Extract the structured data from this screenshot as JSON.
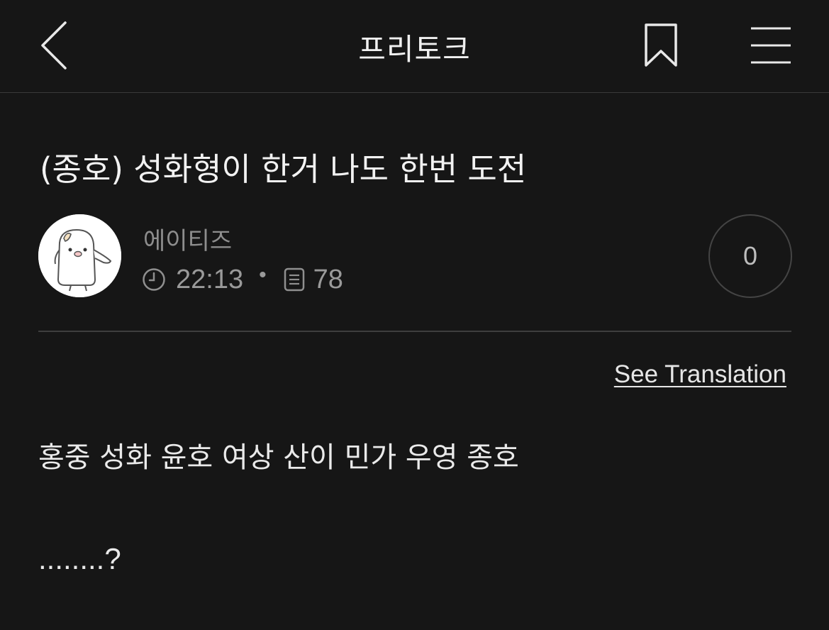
{
  "header": {
    "title": "프리토크",
    "icons": {
      "back": "chevron-left-icon",
      "bookmark": "bookmark-icon",
      "menu": "hamburger-menu-icon"
    }
  },
  "post": {
    "title": "(종호) 성화형이 한거 나도 한번 도전",
    "author": {
      "name": "에이티즈",
      "avatar": "penguin-character-avatar"
    },
    "time": "22:13",
    "views": "78",
    "comment_count": "0",
    "see_translation": "See Translation",
    "body": [
      "홍중 성화 윤호 여상 산이 민가 우영 종호",
      "........?"
    ]
  },
  "colors": {
    "background": "#161616",
    "text": "#ececec",
    "muted": "#8d8d8d",
    "divider": "#3e3e3e"
  }
}
